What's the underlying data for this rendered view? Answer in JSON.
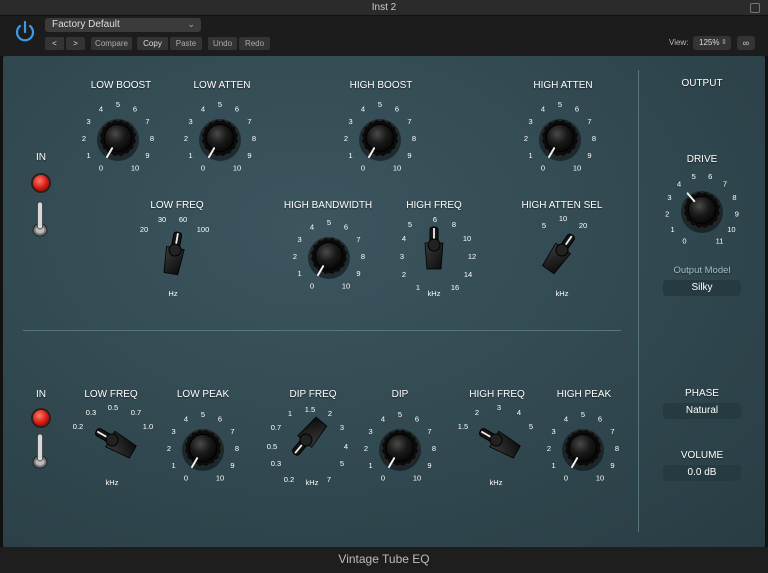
{
  "window": {
    "title": "Inst 2"
  },
  "toolbar": {
    "preset": "Factory Default",
    "prev": "<",
    "next": ">",
    "compare": "Compare",
    "copy": "Copy",
    "paste": "Paste",
    "undo": "Undo",
    "redo": "Redo",
    "view_label": "View:",
    "zoom": "125%",
    "link_icon": "link-icon"
  },
  "plugin_name": "Vintage Tube EQ",
  "top_section": {
    "in_label": "IN",
    "low_boost": {
      "label": "LOW BOOST",
      "scale": [
        "0",
        "1",
        "2",
        "3",
        "4",
        "5",
        "6",
        "7",
        "8",
        "9",
        "10"
      ],
      "value": 0
    },
    "low_atten": {
      "label": "LOW ATTEN",
      "scale": [
        "0",
        "1",
        "2",
        "3",
        "4",
        "5",
        "6",
        "7",
        "8",
        "9",
        "10"
      ],
      "value": 0
    },
    "high_boost": {
      "label": "HIGH BOOST",
      "scale": [
        "0",
        "1",
        "2",
        "3",
        "4",
        "5",
        "6",
        "7",
        "8",
        "9",
        "10"
      ],
      "value": 0
    },
    "high_atten": {
      "label": "HIGH ATTEN",
      "scale": [
        "0",
        "1",
        "2",
        "3",
        "4",
        "5",
        "6",
        "7",
        "8",
        "9",
        "10"
      ],
      "value": 0
    },
    "low_freq": {
      "label": "LOW FREQ",
      "scale": [
        "20",
        "30",
        "60",
        "100"
      ],
      "unit": "Hz",
      "selected": "60"
    },
    "high_bandwidth": {
      "label": "HIGH BANDWIDTH",
      "scale": [
        "0",
        "1",
        "2",
        "3",
        "4",
        "5",
        "6",
        "7",
        "8",
        "9",
        "10"
      ],
      "value": 0
    },
    "high_freq": {
      "label": "HIGH FREQ",
      "scale": [
        "1",
        "2",
        "3",
        "4",
        "5",
        "6",
        "8",
        "10",
        "12",
        "14",
        "16"
      ],
      "unit": "kHz",
      "selected": "6"
    },
    "high_atten_sel": {
      "label": "HIGH ATTEN SEL",
      "scale": [
        "5",
        "10",
        "20"
      ],
      "unit": "kHz",
      "selected": "20"
    }
  },
  "bottom_section": {
    "in_label": "IN",
    "low_freq": {
      "label": "LOW FREQ",
      "scale": [
        "0.2",
        "0.3",
        "0.5",
        "0.7",
        "1.0"
      ],
      "unit": "kHz",
      "selected": "0.2"
    },
    "low_peak": {
      "label": "LOW PEAK",
      "scale": [
        "0",
        "1",
        "2",
        "3",
        "4",
        "5",
        "6",
        "7",
        "8",
        "9",
        "10"
      ],
      "value": 0
    },
    "dip_freq": {
      "label": "DIP FREQ",
      "scale": [
        "0.2",
        "0.3",
        "0.5",
        "0.7",
        "1",
        "1.5",
        "2",
        "3",
        "4",
        "5",
        "7"
      ],
      "unit": "kHz",
      "selected": "0.2"
    },
    "dip": {
      "label": "DIP",
      "scale": [
        "0",
        "1",
        "2",
        "3",
        "4",
        "5",
        "6",
        "7",
        "8",
        "9",
        "10"
      ],
      "value": 0
    },
    "high_freq": {
      "label": "HIGH FREQ",
      "scale": [
        "1.5",
        "2",
        "3",
        "4",
        "5"
      ],
      "unit": "kHz",
      "selected": "1.5"
    },
    "high_peak": {
      "label": "HIGH PEAK",
      "scale": [
        "0",
        "1",
        "2",
        "3",
        "4",
        "5",
        "6",
        "7",
        "8",
        "9",
        "10"
      ],
      "value": 0
    }
  },
  "output_section": {
    "title": "OUTPUT",
    "drive": {
      "label": "DRIVE",
      "scale": [
        "0",
        "1",
        "2",
        "3",
        "4",
        "5",
        "6",
        "7",
        "8",
        "9",
        "10",
        "11"
      ],
      "value": 4
    },
    "output_model": {
      "label": "Output Model",
      "value": "Silky"
    },
    "phase": {
      "label": "PHASE",
      "value": "Natural"
    },
    "volume": {
      "label": "VOLUME",
      "value": "0.0 dB"
    }
  },
  "colors": {
    "panel": "#314850",
    "led": "#d4160f",
    "knob": "#111111",
    "footer_text": "#bcbcbc"
  }
}
